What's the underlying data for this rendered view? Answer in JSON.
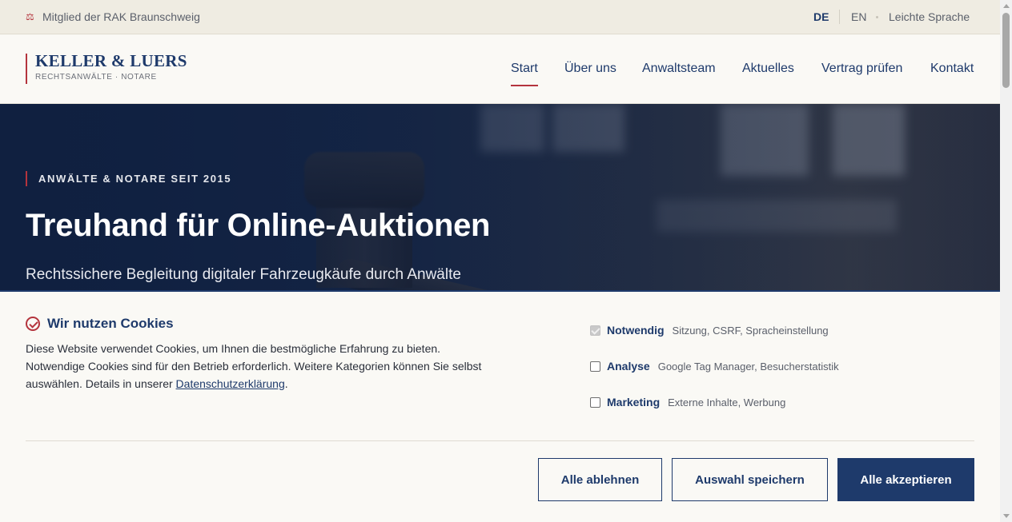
{
  "topbar": {
    "membership": "Mitglied der RAK Braunschweig",
    "membership_icon": "scales-icon",
    "languages": [
      "DE",
      "EN"
    ],
    "active_language": "DE",
    "easy_language": "Leichte Sprache"
  },
  "header": {
    "logo_name": "KELLER & LUERS",
    "logo_sub": "RECHTSANWÄLTE · NOTARE",
    "nav": [
      "Start",
      "Über uns",
      "Anwaltsteam",
      "Aktuelles",
      "Vertrag prüfen",
      "Kontakt"
    ],
    "active_nav": "Start"
  },
  "hero": {
    "kicker": "ANWÄLTE & NOTARE SEIT 2015",
    "title": "Treuhand für Online-Auktionen",
    "subtitle": "Rechtssichere Begleitung digitaler Fahrzeugkäufe durch Anwälte"
  },
  "cookie": {
    "title": "Wir nutzen Cookies",
    "text_before_link": "Diese Website verwendet Cookies, um Ihnen die bestmögliche Erfahrung zu bieten. Notwendige Cookies sind für den Betrieb erforderlich. Weitere Kategorien können Sie selbst auswählen. Details in unserer ",
    "link": "Datenschutzerklärung",
    "text_after_link": ".",
    "options": [
      {
        "name": "Notwendig",
        "desc": "Sitzung, CSRF, Spracheinstellung",
        "checked": true,
        "disabled": true
      },
      {
        "name": "Analyse",
        "desc": "Google Tag Manager, Besucherstatistik",
        "checked": false,
        "disabled": false
      },
      {
        "name": "Marketing",
        "desc": "Externe Inhalte, Werbung",
        "checked": false,
        "disabled": false
      }
    ],
    "buttons": {
      "reject": "Alle ablehnen",
      "save": "Auswahl speichern",
      "accept": "Alle akzeptieren"
    }
  },
  "colors": {
    "primary": "#1e3a6b",
    "accent": "#b4343d",
    "background": "#faf9f5",
    "topbar": "#efece2"
  }
}
